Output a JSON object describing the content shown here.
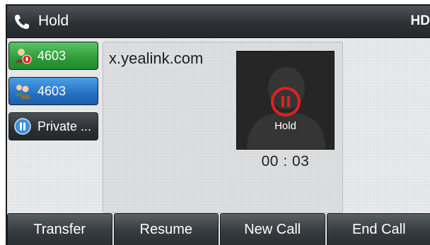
{
  "titlebar": {
    "title": "Hold",
    "hd_badge": "HD",
    "icon": "phone-handset-icon"
  },
  "line_keys": [
    {
      "label": "4603",
      "icon": "contact-mic-muted-icon",
      "color": "#2e9a38"
    },
    {
      "label": "4603",
      "icon": "contacts-group-icon",
      "color": "#2570c4"
    },
    {
      "label": "Private ...",
      "icon": "pause-circle-icon",
      "color": "#2c3034"
    }
  ],
  "call": {
    "remote_party": "x.yealink.com",
    "status_label": "Hold",
    "timer": "00 : 03",
    "status_icon": "pause-ring-icon",
    "accent_color": "#e02020"
  },
  "softkeys": [
    {
      "label": "Transfer"
    },
    {
      "label": "Resume"
    },
    {
      "label": "New Call"
    },
    {
      "label": "End Call"
    }
  ]
}
